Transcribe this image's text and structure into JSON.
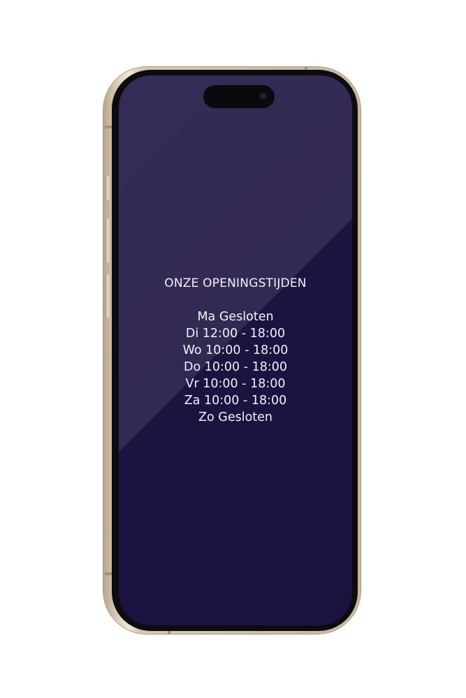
{
  "device": {
    "model_colors": {
      "frame": "#d8c8b0",
      "bezel": "#0c0b10",
      "screen_top": "#342b55",
      "screen_bottom": "#1b123f",
      "text": "#f4f2f8"
    }
  },
  "screen": {
    "title": "ONZE OPENINGSTIJDEN",
    "hours": [
      "Ma Gesloten",
      "Di 12:00 - 18:00",
      "Wo 10:00 - 18:00",
      "Do 10:00 - 18:00",
      "Vr 10:00 - 18:00",
      "Za 10:00 - 18:00",
      "Zo Gesloten"
    ]
  }
}
